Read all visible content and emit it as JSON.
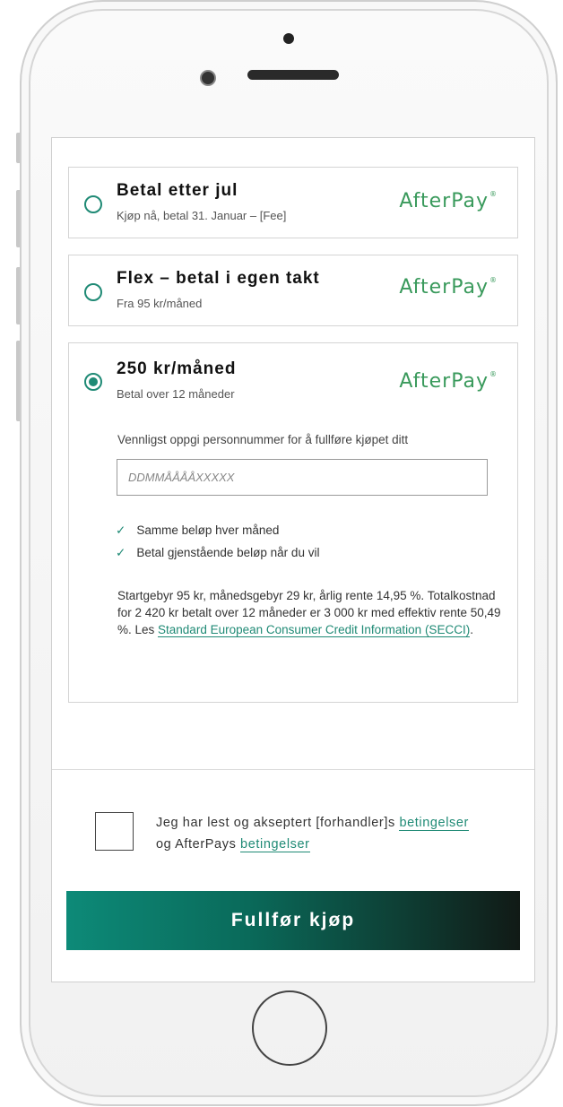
{
  "options": [
    {
      "title": "Betal etter jul",
      "subtitle": "Kjøp nå, betal 31. Januar – [Fee]",
      "logo": "AfterPay",
      "selected": false
    },
    {
      "title": "Flex – betal i egen takt",
      "subtitle": "Fra 95 kr/måned",
      "logo": "AfterPay",
      "selected": false
    },
    {
      "title": "250 kr/måned",
      "subtitle": "Betal over 12 måneder",
      "logo": "AfterPay",
      "selected": true
    }
  ],
  "details": {
    "instruction": "Vennligst oppgi personnummer for å fullføre kjøpet ditt",
    "pnr_placeholder": "DDMMÅÅÅÅXXXXX",
    "benefits": [
      "Samme beløp hver måned",
      "Betal gjenstående beløp når du vil"
    ],
    "terms_prefix": "Startgebyr 95 kr, månedsgebyr 29 kr, årlig rente 14,95 %. Totalkostnad for 2 420 kr betalt over 12 måneder er 3 000 kr med effektiv rente 50,49 %. Les ",
    "terms_link": "Standard European Consumer Credit Information (SECCI)",
    "terms_suffix": "."
  },
  "accept": {
    "text_1": "Jeg har lest og akseptert [forhandler]s ",
    "link_1": "betingelser",
    "text_2": "og AfterPays ",
    "link_2": "betingelser",
    "checked": false
  },
  "submit_label": "Fullfør kjøp",
  "colors": {
    "accent": "#1f8a75",
    "logo": "#3a9a5c",
    "button_start": "#0d8a78",
    "button_end": "#111a16"
  },
  "icons": {
    "check": "check-icon",
    "radio": "radio-icon"
  }
}
